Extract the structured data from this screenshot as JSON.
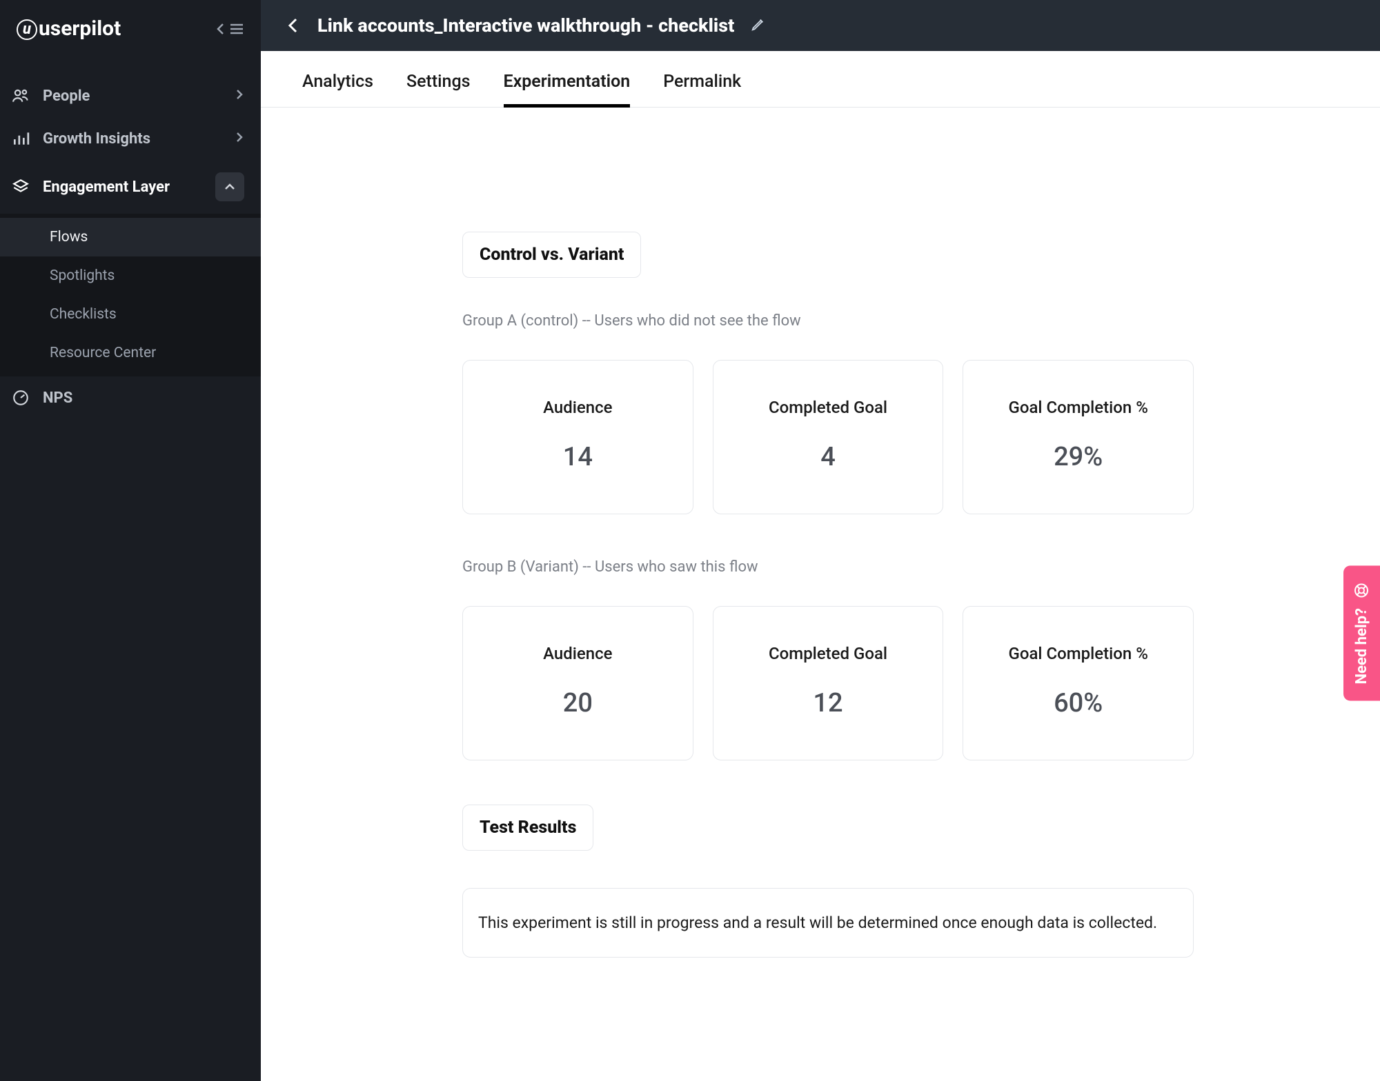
{
  "brand": "userpilot",
  "sidebar": {
    "items": [
      {
        "label": "People"
      },
      {
        "label": "Growth Insights"
      },
      {
        "label": "Engagement Layer"
      },
      {
        "label": "NPS"
      }
    ],
    "engagement_sub": [
      {
        "label": "Flows"
      },
      {
        "label": "Spotlights"
      },
      {
        "label": "Checklists"
      },
      {
        "label": "Resource Center"
      }
    ]
  },
  "header": {
    "title": "Link accounts_Interactive walkthrough - checklist"
  },
  "tabs": [
    {
      "label": "Analytics"
    },
    {
      "label": "Settings"
    },
    {
      "label": "Experimentation"
    },
    {
      "label": "Permalink"
    }
  ],
  "experimentation": {
    "section_title": "Control vs. Variant",
    "group_a_label": "Group A (control) -- Users who did not see the flow",
    "group_b_label": "Group B (Variant) -- Users who saw this flow",
    "stat_labels": {
      "audience": "Audience",
      "completed": "Completed Goal",
      "rate": "Goal Completion %"
    },
    "group_a": {
      "audience": "14",
      "completed": "4",
      "rate": "29%"
    },
    "group_b": {
      "audience": "20",
      "completed": "12",
      "rate": "60%"
    },
    "results_title": "Test Results",
    "results_text": "This experiment is still in progress and a result will be determined once enough data is collected."
  },
  "help_label": "Need help?"
}
